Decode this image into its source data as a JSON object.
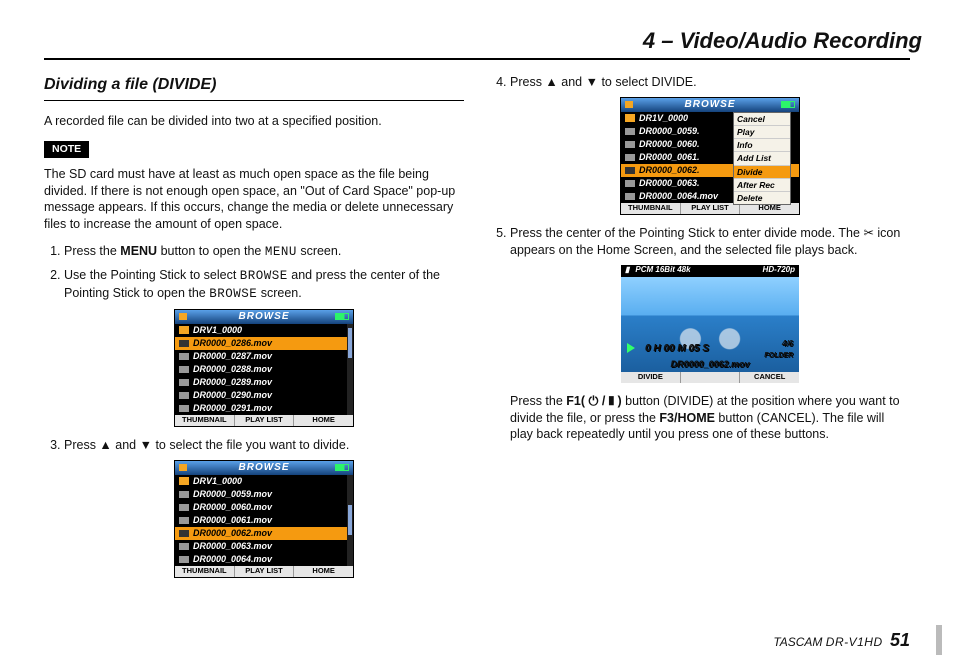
{
  "header": {
    "title": "4 – Video/Audio Recording"
  },
  "section": {
    "heading": "Dividing a file (DIVIDE)"
  },
  "intro": "A recorded file can be divided into two at a specified position.",
  "note": {
    "label": "NOTE",
    "text": "The SD card must have at least as much open space as the file being divided. If there is not enough open space, an \"Out of Card Space\" pop-up message appears. If this occurs, change the media or delete unnecessary files to increase the amount of open space."
  },
  "steps": {
    "s1_a": "Press the ",
    "s1_bold": "MENU",
    "s1_b": " button to open the ",
    "s1_lcd": "MENU",
    "s1_c": " screen.",
    "s2_a": "Use the Pointing Stick to select ",
    "s2_lcd1": "BROWSE",
    "s2_b": " and press the center of the Pointing Stick to open the ",
    "s2_lcd2": "BROWSE",
    "s2_c": " screen.",
    "s3": "Press ▲ and ▼ to select the file you want to divide.",
    "s4": "Press ▲ and ▼ to select DIVIDE.",
    "s5_a": "Press the center of the Pointing Stick to enter divide mode. The ",
    "s5_b": " icon appears on the Home Screen, and the selected file plays back.",
    "s5_sub_a": "Press the ",
    "s5_sub_bold": "F1( ⏻ / ❚ )",
    "s5_sub_b": " button (DIVIDE) at the position where you want to divide the file, or press the ",
    "s5_sub_bold2": "F3/HOME",
    "s5_sub_c": " button (CANCEL). The file will play back repeatedly until you press one of these buttons."
  },
  "screen1": {
    "title": "BROWSE",
    "folder": "DRV1_0000",
    "files": [
      "DR0000_0286.mov",
      "DR0000_0287.mov",
      "DR0000_0288.mov",
      "DR0000_0289.mov",
      "DR0000_0290.mov",
      "DR0000_0291.mov"
    ],
    "selected_index": 0,
    "softkeys": [
      "THUMBNAIL",
      "PLAY LIST",
      "HOME"
    ]
  },
  "screen2": {
    "title": "BROWSE",
    "folder": "DRV1_0000",
    "files": [
      "DR0000_0059.mov",
      "DR0000_0060.mov",
      "DR0000_0061.mov",
      "DR0000_0062.mov",
      "DR0000_0063.mov",
      "DR0000_0064.mov"
    ],
    "selected_index": 3,
    "softkeys": [
      "THUMBNAIL",
      "PLAY LIST",
      "HOME"
    ]
  },
  "screen3": {
    "title": "BROWSE",
    "folder": "DR1V_0000",
    "files": [
      "DR0000_0059.",
      "DR0000_0060.",
      "DR0000_0061.",
      "DR0000_0062.",
      "DR0000_0063.",
      "DR0000_0064.mov"
    ],
    "selected_index": 3,
    "menu": [
      "Cancel",
      "Play",
      "Info",
      "Add List",
      "Divide",
      "After Rec",
      "Delete"
    ],
    "menu_selected_index": 4,
    "softkeys": [
      "THUMBNAIL",
      "PLAY LIST",
      "HOME"
    ]
  },
  "preview": {
    "format": "PCM 16Bit 48k",
    "res": "HD-720p",
    "timecode": "0 H 00 M 05 S",
    "track": "4/6",
    "folder_lbl": "FOLDER",
    "filename": "DR0000_0062.mov",
    "softkeys": [
      "DIVIDE",
      "",
      "CANCEL"
    ]
  },
  "footer": {
    "brand": "TASCAM",
    "model": "DR-V1HD",
    "page": "51"
  }
}
